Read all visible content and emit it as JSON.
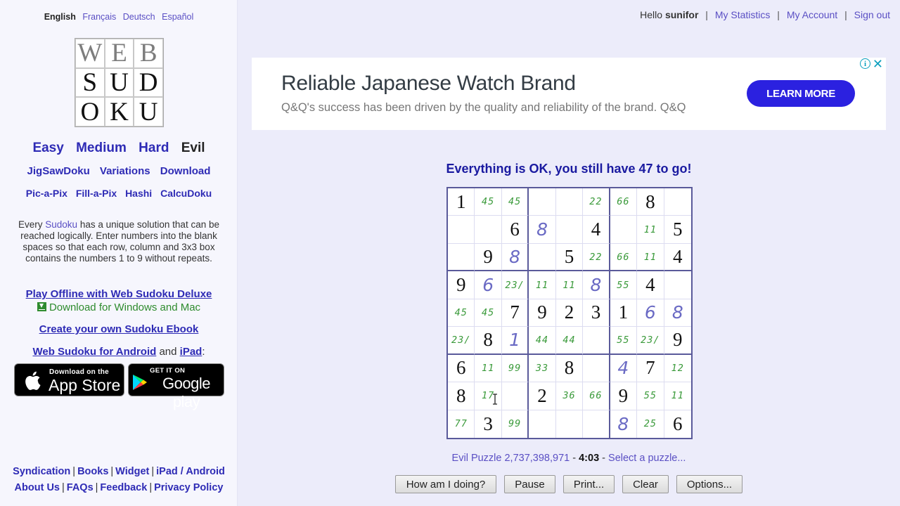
{
  "languages": {
    "current": "English",
    "others": [
      "Français",
      "Deutsch",
      "Español"
    ]
  },
  "logo": {
    "letters": [
      "W",
      "E",
      "B",
      "S",
      "U",
      "D",
      "O",
      "K",
      "U"
    ]
  },
  "levels": {
    "items": [
      "Easy",
      "Medium",
      "Hard",
      "Evil"
    ],
    "current": "Evil"
  },
  "nav_secondary": [
    "JigSawDoku",
    "Variations",
    "Download"
  ],
  "nav_tertiary": [
    "Pic-a-Pix",
    "Fill-a-Pix",
    "Hashi",
    "CalcuDoku"
  ],
  "description": {
    "prefix": "Every ",
    "link": "Sudoku",
    "suffix": " has a unique solution that can be reached logically. Enter numbers into the blank spaces so that each row, column and 3x3 box contains the numbers 1 to 9 without repeats."
  },
  "promos": {
    "deluxe": "Play Offline with Web Sudoku Deluxe",
    "download": "Download for Windows and Mac",
    "ebook": "Create your own Sudoku Ebook",
    "android": "Web Sudoku for Android",
    "and": "and",
    "ipad": "iPad",
    "colon": ":"
  },
  "stores": {
    "apple_small": "Download on the",
    "apple_big": "App Store",
    "google_small": "GET IT ON",
    "google_big": "Google play"
  },
  "footer": {
    "row1": [
      "Syndication",
      "Books",
      "Widget",
      "iPad / Android"
    ],
    "row2": [
      "About Us",
      "FAQs",
      "Feedback",
      "Privacy Policy"
    ]
  },
  "userbar": {
    "hello": "Hello",
    "username": "sunifor",
    "links": [
      "My Statistics",
      "My Account",
      "Sign out"
    ]
  },
  "ad": {
    "title": "Reliable Japanese Watch Brand",
    "subtitle": "Q&Q's success has been driven by the quality and reliability of the brand. Q&Q",
    "button": "LEARN MORE",
    "info": "i",
    "close": "✕"
  },
  "status_message": "Everything is OK, you still have 47 to go!",
  "board": {
    "cells": [
      [
        {
          "t": "given",
          "v": "1"
        },
        {
          "t": "note",
          "v": "45"
        },
        {
          "t": "note",
          "v": "45"
        },
        {
          "t": "empty",
          "v": ""
        },
        {
          "t": "empty",
          "v": ""
        },
        {
          "t": "note",
          "v": "22"
        },
        {
          "t": "note",
          "v": "66"
        },
        {
          "t": "given",
          "v": "8"
        },
        {
          "t": "empty",
          "v": ""
        }
      ],
      [
        {
          "t": "empty",
          "v": ""
        },
        {
          "t": "empty",
          "v": ""
        },
        {
          "t": "given",
          "v": "6"
        },
        {
          "t": "entry",
          "v": "8"
        },
        {
          "t": "empty",
          "v": ""
        },
        {
          "t": "given",
          "v": "4"
        },
        {
          "t": "empty",
          "v": ""
        },
        {
          "t": "note",
          "v": "11"
        },
        {
          "t": "given",
          "v": "5"
        }
      ],
      [
        {
          "t": "empty",
          "v": ""
        },
        {
          "t": "given",
          "v": "9"
        },
        {
          "t": "entry",
          "v": "8"
        },
        {
          "t": "empty",
          "v": ""
        },
        {
          "t": "given",
          "v": "5"
        },
        {
          "t": "note",
          "v": "22"
        },
        {
          "t": "note",
          "v": "66"
        },
        {
          "t": "note",
          "v": "11"
        },
        {
          "t": "given",
          "v": "4"
        }
      ],
      [
        {
          "t": "given",
          "v": "9"
        },
        {
          "t": "entry",
          "v": "6"
        },
        {
          "t": "note",
          "v": "23/"
        },
        {
          "t": "note",
          "v": "11"
        },
        {
          "t": "note",
          "v": "11"
        },
        {
          "t": "entry",
          "v": "8"
        },
        {
          "t": "note",
          "v": "55"
        },
        {
          "t": "given",
          "v": "4"
        },
        {
          "t": "empty",
          "v": ""
        }
      ],
      [
        {
          "t": "note",
          "v": "45"
        },
        {
          "t": "note",
          "v": "45"
        },
        {
          "t": "given",
          "v": "7"
        },
        {
          "t": "given",
          "v": "9"
        },
        {
          "t": "given",
          "v": "2"
        },
        {
          "t": "given",
          "v": "3"
        },
        {
          "t": "given",
          "v": "1"
        },
        {
          "t": "entry",
          "v": "6"
        },
        {
          "t": "entry",
          "v": "8"
        }
      ],
      [
        {
          "t": "note",
          "v": "23/"
        },
        {
          "t": "given",
          "v": "8"
        },
        {
          "t": "entry",
          "v": "1"
        },
        {
          "t": "note",
          "v": "44"
        },
        {
          "t": "note",
          "v": "44"
        },
        {
          "t": "empty",
          "v": ""
        },
        {
          "t": "note",
          "v": "55"
        },
        {
          "t": "note",
          "v": "23/"
        },
        {
          "t": "given",
          "v": "9"
        }
      ],
      [
        {
          "t": "given",
          "v": "6"
        },
        {
          "t": "note",
          "v": "11"
        },
        {
          "t": "note",
          "v": "99"
        },
        {
          "t": "note",
          "v": "33"
        },
        {
          "t": "given",
          "v": "8"
        },
        {
          "t": "empty",
          "v": ""
        },
        {
          "t": "entry",
          "v": "4"
        },
        {
          "t": "given",
          "v": "7"
        },
        {
          "t": "note",
          "v": "12"
        }
      ],
      [
        {
          "t": "given",
          "v": "8"
        },
        {
          "t": "note",
          "v": "17"
        },
        {
          "t": "empty",
          "v": ""
        },
        {
          "t": "given",
          "v": "2"
        },
        {
          "t": "note",
          "v": "36"
        },
        {
          "t": "note",
          "v": "66"
        },
        {
          "t": "given",
          "v": "9"
        },
        {
          "t": "note",
          "v": "55"
        },
        {
          "t": "note",
          "v": "11"
        }
      ],
      [
        {
          "t": "note",
          "v": "77"
        },
        {
          "t": "given",
          "v": "3"
        },
        {
          "t": "note",
          "v": "99"
        },
        {
          "t": "empty",
          "v": ""
        },
        {
          "t": "empty",
          "v": ""
        },
        {
          "t": "empty",
          "v": ""
        },
        {
          "t": "entry",
          "v": "8"
        },
        {
          "t": "note",
          "v": "25"
        },
        {
          "t": "given",
          "v": "6"
        }
      ]
    ]
  },
  "puzzle_info": {
    "label": "Evil Puzzle 2,737,398,971",
    "sep1": " - ",
    "time": "4:03",
    "sep2": " - ",
    "select": "Select a puzzle..."
  },
  "buttons": [
    "How am I doing?",
    "Pause",
    "Print...",
    "Clear",
    "Options..."
  ],
  "colors": {
    "link": "#2e2bb5",
    "status": "#1a1aa0",
    "note": "#3a9a3a",
    "entry": "#6a6ac4",
    "ad_button": "#2b21e0"
  }
}
